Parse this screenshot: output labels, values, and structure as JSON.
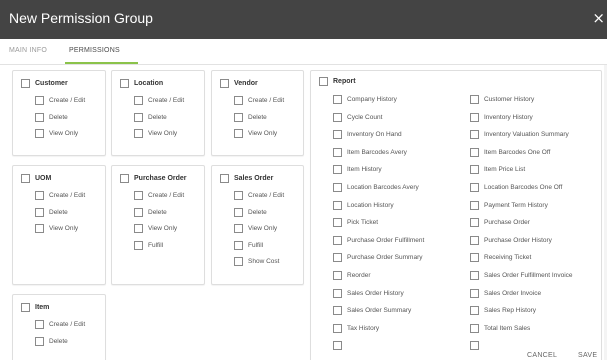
{
  "dialog": {
    "title": "New Permission Group",
    "close_icon": "×"
  },
  "tabs": [
    {
      "label": "MAIN INFO",
      "active": false
    },
    {
      "label": "PERMISSIONS",
      "active": true
    }
  ],
  "accent_color": "#8bc34a",
  "groups": {
    "customer": {
      "title": "Customer",
      "items": [
        "Create / Edit",
        "Delete",
        "View Only"
      ]
    },
    "location": {
      "title": "Location",
      "items": [
        "Create / Edit",
        "Delete",
        "View Only"
      ]
    },
    "vendor": {
      "title": "Vendor",
      "items": [
        "Create / Edit",
        "Delete",
        "View Only"
      ]
    },
    "uom": {
      "title": "UOM",
      "items": [
        "Create / Edit",
        "Delete",
        "View Only"
      ]
    },
    "purchase_order": {
      "title": "Purchase Order",
      "items": [
        "Create / Edit",
        "Delete",
        "View Only",
        "Fulfill"
      ]
    },
    "sales_order": {
      "title": "Sales Order",
      "items": [
        "Create / Edit",
        "Delete",
        "View Only",
        "Fulfill",
        "Show Cost"
      ]
    },
    "item": {
      "title": "Item",
      "items": [
        "Create / Edit",
        "Delete"
      ]
    }
  },
  "report": {
    "title": "Report",
    "left": [
      "Company History",
      "Cycle Count",
      "Inventory On Hand",
      "Item Barcodes Avery",
      "Item History",
      "Location Barcodes Avery",
      "Location History",
      "Pick Ticket",
      "Purchase Order Fulfillment",
      "Purchase Order Summary",
      "Reorder",
      "Sales Order History",
      "Sales Order Summary",
      "Tax History"
    ],
    "right": [
      "Customer History",
      "Inventory History",
      "Inventory Valuation Summary",
      "Item Barcodes One Off",
      "Item Price List",
      "Location Barcodes One Off",
      "Payment Term History",
      "Purchase Order",
      "Purchase Order History",
      "Receiving Ticket",
      "Sales Order Fulfillment Invoice",
      "Sales Order Invoice",
      "Sales Rep History",
      "Total Item Sales"
    ]
  },
  "footer": {
    "cancel": "CANCEL",
    "save": "SAVE"
  }
}
